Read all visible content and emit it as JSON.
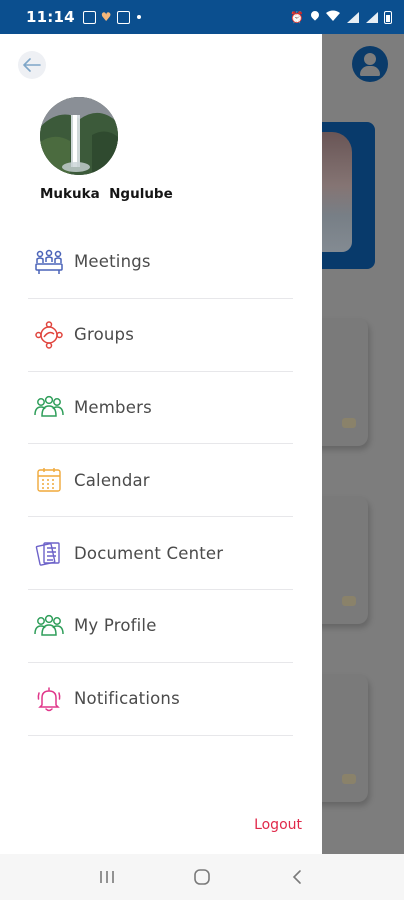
{
  "status_bar": {
    "time": "11:14",
    "icons": [
      "image-icon",
      "heart-icon",
      "app-icon",
      "alarm-icon",
      "location-icon",
      "wifi-icon",
      "signal-icon",
      "signal-icon",
      "battery-icon"
    ]
  },
  "drawer": {
    "back_icon": "arrow-left-icon",
    "profile": {
      "name": "Mukuka  Ngulube"
    },
    "menu": [
      {
        "label": "Meetings",
        "icon": "meetings-icon",
        "color": "#4a63b8"
      },
      {
        "label": "Groups",
        "icon": "groups-icon",
        "color": "#e0453e"
      },
      {
        "label": "Members",
        "icon": "members-icon",
        "color": "#2f9e5a"
      },
      {
        "label": "Calendar",
        "icon": "calendar-icon",
        "color": "#f0a93a"
      },
      {
        "label": "Document Center",
        "icon": "document-icon",
        "color": "#6d62c9"
      },
      {
        "label": "My Profile",
        "icon": "profile-icon",
        "color": "#2f9e5a"
      },
      {
        "label": "Notifications",
        "icon": "bell-icon",
        "color": "#e0368a"
      }
    ],
    "logout_label": "Logout",
    "logout_color": "#e0294a"
  },
  "background": {
    "avatar_icon": "user-avatar-icon"
  },
  "nav_bar": {
    "buttons": [
      "recent-apps-icon",
      "home-icon",
      "back-icon"
    ]
  },
  "colors": {
    "status_bar": "#0b4f8f",
    "overlay": "#7d7d7d",
    "accent": "#0a3b6a"
  }
}
